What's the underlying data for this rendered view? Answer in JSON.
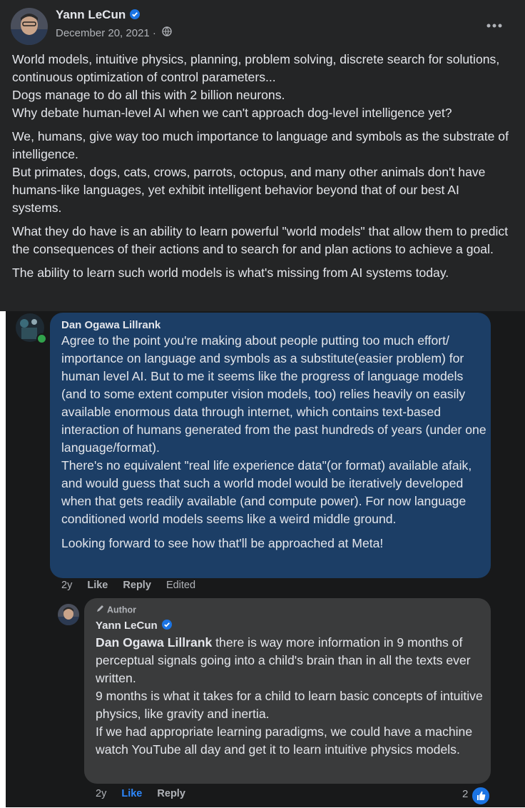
{
  "post": {
    "author": "Yann LeCun",
    "date": "December 20, 2021 ·",
    "paragraphs": [
      "World models, intuitive physics, planning, problem solving, discrete search for solutions, continuous optimization of control parameters...\nDogs manage to do all this with 2 billion neurons.\nWhy debate human-level AI when we can't approach dog-level intelligence yet?",
      "We, humans, give way too much importance to language and symbols as the substrate of intelligence.\nBut primates, dogs, cats, crows, parrots, octopus, and many other animals don't have humans-like languages, yet exhibit intelligent behavior beyond that of our best AI systems.",
      "What they do have is an ability to learn powerful \"world models\" that allow them to predict the consequences of their actions and to search for and plan actions to achieve a goal.",
      "The ability to learn such world models is what's missing from AI systems today."
    ]
  },
  "comment1": {
    "author": "Dan Ogawa Lillrank",
    "paragraph1": "Agree to the point you're making about people putting too much effort/ importance on language and symbols as a substitute(easier problem) for human level AI. But to me it seems like the progress of language models (and to some extent computer vision models, too) relies heavily on easily available enormous data through internet, which contains text-based interaction of humans generated from the past hundreds of years (under one language/format).\nThere's no equivalent \"real life experience data\"(or format) available afaik, and would guess that such a world model would be iteratively developed when that gets readily available (and compute power). For now language conditioned world models seems like a weird middle ground.",
    "paragraph2": "Looking forward to see how that'll be approached at Meta!",
    "time": "2y",
    "like": "Like",
    "reply": "Reply",
    "edited": "Edited"
  },
  "comment2": {
    "badge": "Author",
    "author": "Yann LeCun",
    "mention": "Dan Ogawa Lillrank",
    "text_after_mention": " there is way more information in 9 months of perceptual signals going into a child's brain than in all the texts ever written.\n9 months is what it takes for a child to learn basic concepts of intuitive physics, like gravity and inertia.\nIf we had appropriate learning paradigms, we could have a machine watch YouTube all day and get it to learn intuitive physics models.",
    "time": "2y",
    "like": "Like",
    "reply": "Reply",
    "reaction_count": "2"
  },
  "colors": {
    "post_bg": "#242526",
    "comments_bg": "#18191a",
    "highlight_bubble": "#1c3e66",
    "bubble": "#3a3b3c",
    "accent": "#1b74e4"
  }
}
